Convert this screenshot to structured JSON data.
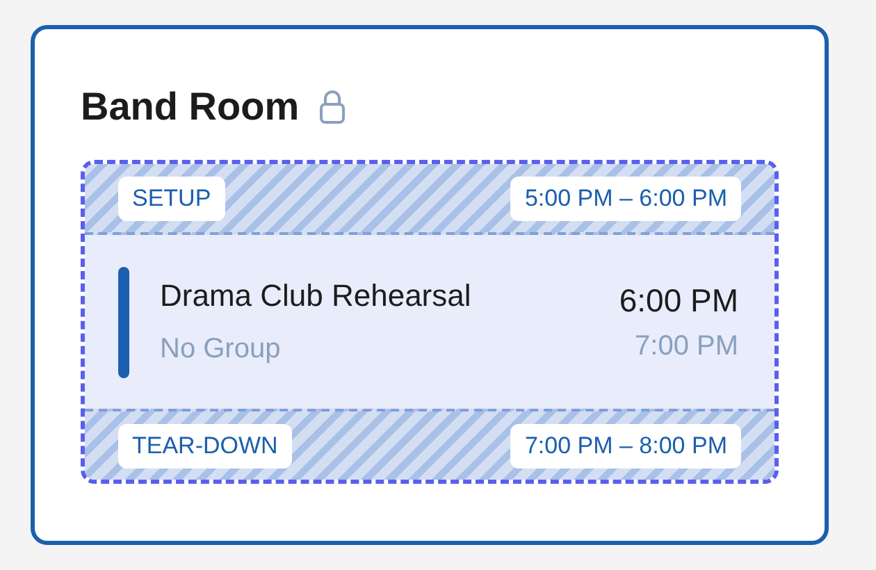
{
  "room": {
    "title": "Band Room",
    "locked": true
  },
  "booking": {
    "setup": {
      "label": "SETUP",
      "time": "5:00 PM – 6:00 PM"
    },
    "event": {
      "title": "Drama Club Rehearsal",
      "group": "No Group",
      "start": "6:00 PM",
      "end": "7:00 PM"
    },
    "teardown": {
      "label": "TEAR-DOWN",
      "time": "7:00 PM – 8:00 PM"
    }
  }
}
